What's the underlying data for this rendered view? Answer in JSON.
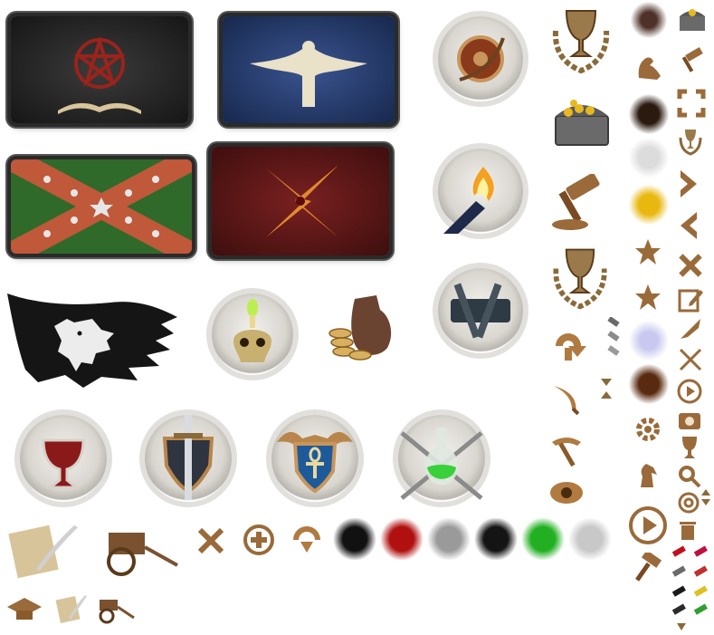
{
  "sheet": {
    "background": "#ffffff",
    "bronze": "#9a6a3a",
    "bronze_light": "#c8955a",
    "bronze_dark": "#5e3a1a"
  },
  "flags": [
    {
      "name": "flag-pentagram-book",
      "cloth": "#2a2a2a",
      "emblem": "#8a1e1a"
    },
    {
      "name": "flag-white-eagle",
      "cloth": "#243a6a",
      "emblem": "#e8e0c8"
    },
    {
      "name": "flag-confederate-green",
      "cloth": "#2f6a2a",
      "emblem": "#c0583a"
    },
    {
      "name": "flag-red-lightning",
      "cloth": "#6a1a1a",
      "emblem": "#e08a30"
    },
    {
      "name": "flag-black-wolf-banner",
      "cloth": "#151515",
      "emblem": "#e8e8e8"
    }
  ],
  "ring_icons": [
    "shield-bow-icon",
    "torch-icon",
    "hammer-tools-icon",
    "skull-candle-icon",
    "chalice-icon",
    "sword-shield-icon",
    "ankh-shield-icon",
    "potion-swords-icon"
  ],
  "small_icons": [
    "trophy-wreath-icon",
    "treasure-chest-icon",
    "gavel-icon",
    "trophy-wreath-small-icon",
    "refresh-arrow-icon",
    "scimitar-icon",
    "pickaxe-icon",
    "eye-icon",
    "play-button-icon",
    "hammer-icon",
    "star-icon",
    "crossed-tools-icon",
    "edit-icon",
    "quill-icon",
    "crossed-swords-icon",
    "play-circle-icon",
    "camera-icon",
    "trophy-icon",
    "search-icon",
    "at-sign-icon",
    "trash-icon",
    "chevron-right-icon",
    "chevron-left-icon",
    "fullscreen-icon",
    "knight-icon",
    "gear-icon",
    "scroll-quill-icon",
    "cart-icon",
    "graduation-cap-icon",
    "coin-pouch-icon",
    "axe-cross-icon",
    "plus-circle-icon",
    "download-arrow-icon"
  ],
  "particle_colors": [
    "#111111",
    "#b01010",
    "#9a9a9a",
    "#141414",
    "#22b022",
    "#c8c8c8",
    "#3a1a10",
    "#e0e0e0",
    "#e8b810",
    "#ffffff",
    "#5a2a10"
  ]
}
